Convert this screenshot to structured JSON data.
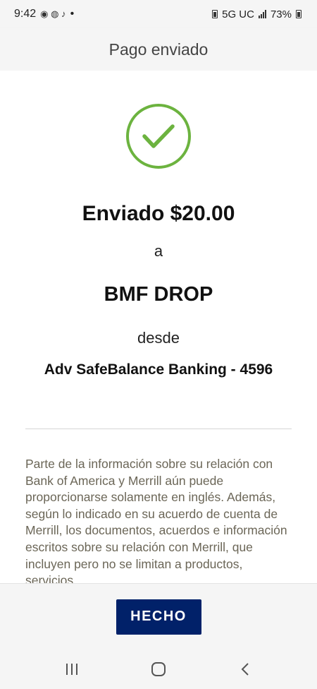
{
  "status_bar": {
    "time": "9:42",
    "dot": "•",
    "network": "5G UC",
    "battery": "73%"
  },
  "header": {
    "title": "Pago enviado"
  },
  "confirmation": {
    "amount_text": "Enviado $20.00",
    "prep_to": "a",
    "recipient": "BMF DROP",
    "prep_from": "desde",
    "account": "Adv SafeBalance Banking - 4596"
  },
  "disclaimer": {
    "text": "Parte de la información sobre su relación con Bank of America y Merrill aún puede proporcionarse solamente en inglés. Además, según lo indicado en su acuerdo de cuenta de Merrill, los documentos, acuerdos e información escritos sobre su relación con Merrill, que incluyen pero no se limitan a productos, servicios"
  },
  "footer": {
    "done_label": "HECHO"
  },
  "colors": {
    "check_green": "#6cb33f",
    "button_navy": "#012169",
    "disclaimer_text": "#6b6657"
  },
  "icons": {
    "check": "check-circle-icon",
    "recents": "recents-icon",
    "home": "home-icon",
    "back": "back-icon"
  }
}
